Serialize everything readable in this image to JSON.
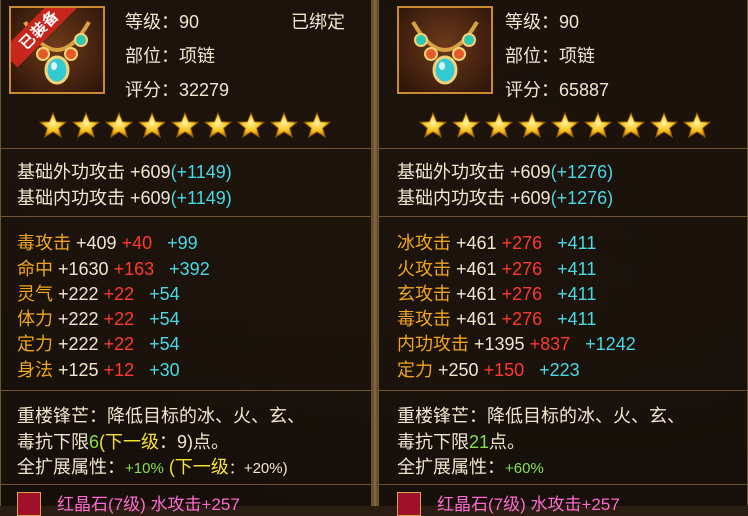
{
  "left": {
    "equipped_badge": "已装备",
    "level_label": "等级：",
    "level": "90",
    "bound": "已绑定",
    "slot_label": "部位：",
    "slot": "项链",
    "score_label": "评分：",
    "score": "32279",
    "star_count": 9,
    "base_stats": [
      {
        "name": "基础外功攻击",
        "value": "+609",
        "bonus": "(+1149)"
      },
      {
        "name": "基础内功攻击",
        "value": "+609",
        "bonus": "(+1149)"
      }
    ],
    "attrs": [
      {
        "name": "毒攻击",
        "base": "+409",
        "red": "+40",
        "cyan": "+99"
      },
      {
        "name": "命中",
        "base": "+1630",
        "red": "+163",
        "cyan": "+392"
      },
      {
        "name": "灵气",
        "base": "+222",
        "red": "+22",
        "cyan": "+54"
      },
      {
        "name": "体力",
        "base": "+222",
        "red": "+22",
        "cyan": "+54"
      },
      {
        "name": "定力",
        "base": "+222",
        "red": "+22",
        "cyan": "+54"
      },
      {
        "name": "身法",
        "base": "+125",
        "red": "+12",
        "cyan": "+30"
      }
    ],
    "special_line1": "重楼锋芒：降低目标的冰、火、玄、",
    "special_line2_a": "毒抗下限",
    "special_line2_num": "6",
    "special_line2_b": "(下一级",
    "special_line2_c": "：9)",
    "special_line2_d": "点。",
    "ext_label": "全扩展属性：",
    "ext_value": "+10%",
    "ext_next_a": "(下一级",
    "ext_next_b": "：+20%)",
    "gem_text": "红晶石(7级)  水攻击+257"
  },
  "right": {
    "level_label": "等级：",
    "level": "90",
    "slot_label": "部位：",
    "slot": "项链",
    "score_label": "评分：",
    "score": "65887",
    "star_count": 9,
    "base_stats": [
      {
        "name": "基础外功攻击",
        "value": "+609",
        "bonus": "(+1276)"
      },
      {
        "name": "基础内功攻击",
        "value": "+609",
        "bonus": "(+1276)"
      }
    ],
    "attrs": [
      {
        "name": "冰攻击",
        "base": "+461",
        "red": "+276",
        "cyan": "+411"
      },
      {
        "name": "火攻击",
        "base": "+461",
        "red": "+276",
        "cyan": "+411"
      },
      {
        "name": "玄攻击",
        "base": "+461",
        "red": "+276",
        "cyan": "+411"
      },
      {
        "name": "毒攻击",
        "base": "+461",
        "red": "+276",
        "cyan": "+411"
      },
      {
        "name": "内功攻击",
        "base": "+1395",
        "red": "+837",
        "cyan": "+1242"
      },
      {
        "name": "定力",
        "base": "+250",
        "red": "+150",
        "cyan": "+223"
      }
    ],
    "special_line1": "重楼锋芒：降低目标的冰、火、玄、",
    "special_line2_a": "毒抗下限",
    "special_line2_num": "21",
    "special_line2_d": "点。",
    "ext_label": "全扩展属性：",
    "ext_value": "+60%",
    "gem_text": "红晶石(7级)  水攻击+257"
  }
}
